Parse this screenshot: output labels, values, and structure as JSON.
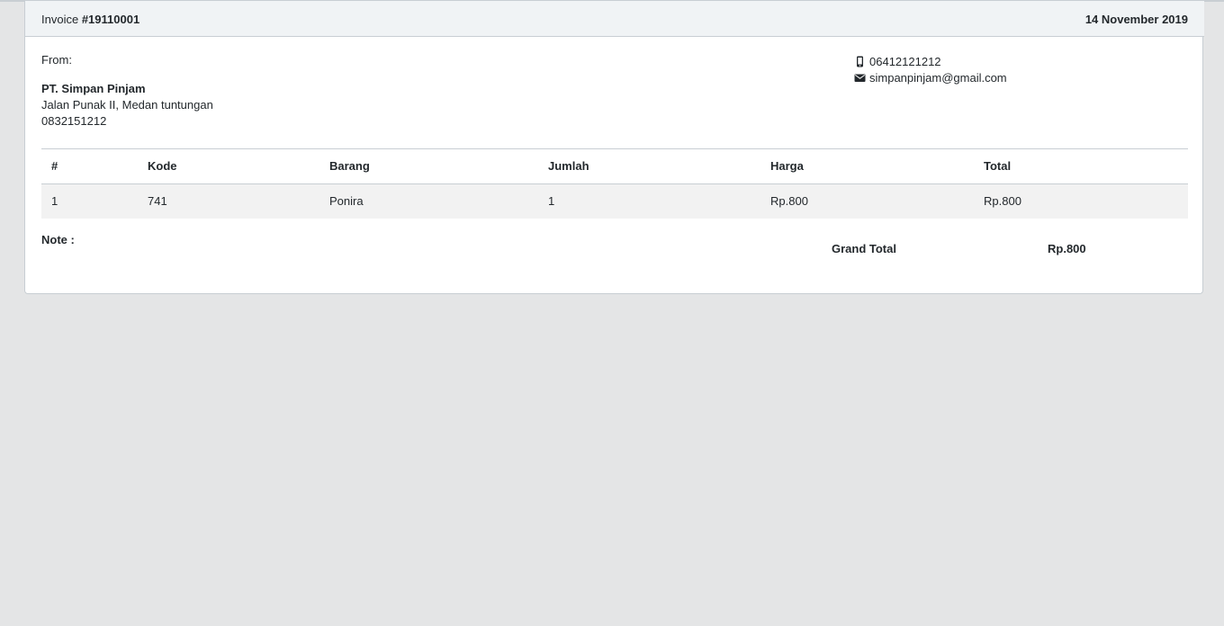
{
  "header": {
    "invoice_label": "Invoice",
    "invoice_number": "#19110001",
    "date": "14 November 2019"
  },
  "sender": {
    "from_label": "From:",
    "company_name": "PT. Simpan Pinjam",
    "address": "Jalan Punak II, Medan tuntungan",
    "phone": "0832151212"
  },
  "contact": {
    "phone": "06412121212",
    "phone_icon": "mobile-phone-icon",
    "email": "simpanpinjam@gmail.com",
    "email_icon": "envelope-icon"
  },
  "table": {
    "columns": [
      "#",
      "Kode",
      "Barang",
      "Jumlah",
      "Harga",
      "Total"
    ],
    "rows": [
      [
        "1",
        "741",
        "Ponira",
        "1",
        "Rp.800",
        "Rp.800"
      ]
    ]
  },
  "footer": {
    "note_label": "Note :",
    "grand_total_label": "Grand Total",
    "grand_total_value": "Rp.800"
  },
  "colors": {
    "page_background": "#e4e5e6",
    "card_header_background": "#f0f3f5",
    "row_background": "#f2f2f2",
    "border": "#c8ced3",
    "text": "#23282c"
  }
}
